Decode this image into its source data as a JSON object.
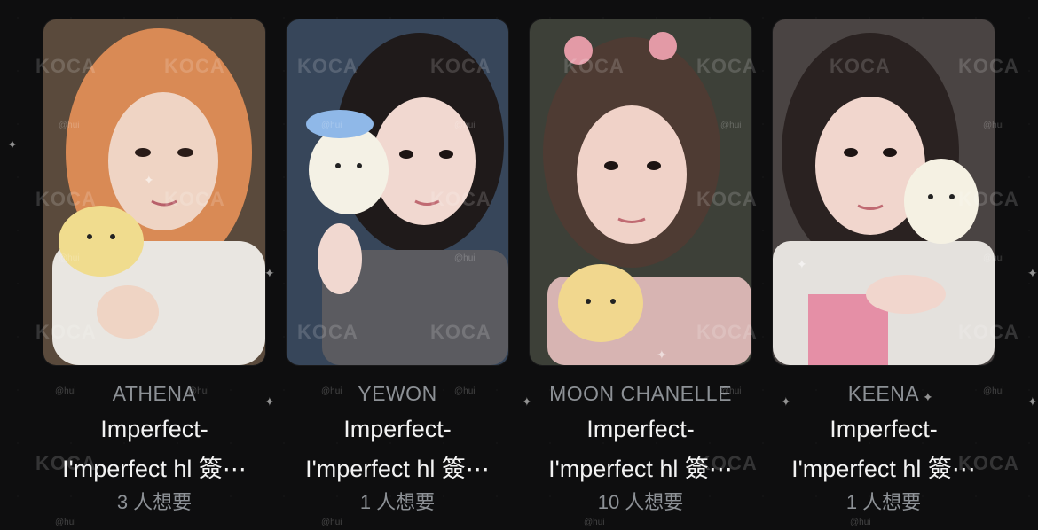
{
  "watermark": {
    "brand": "KOCA",
    "handle": "@hui"
  },
  "cards": [
    {
      "member": "ATHENA",
      "title_line1": "Imperfect-",
      "title_line2": "I'mperfect hl 簽⋯",
      "wants": "3 人想要",
      "colors": {
        "bg": "#5a4a3c",
        "hair": "#d98a55",
        "skin": "#efd4c4",
        "shirt": "#e9e6e1",
        "plush": "#f0dc8e"
      }
    },
    {
      "member": "YEWON",
      "title_line1": "Imperfect-",
      "title_line2": "I'mperfect hl 簽⋯",
      "wants": "1 人想要",
      "colors": {
        "bg": "#37465a",
        "hair": "#1f1a1a",
        "skin": "#f1d8d0",
        "shirt": "#5b5b60",
        "plush": "#f4f1e5"
      }
    },
    {
      "member": "MOON CHANELLE",
      "title_line1": "Imperfect-",
      "title_line2": "I'mperfect hl 簽⋯",
      "wants": "10 人想要",
      "colors": {
        "bg": "#3d4038",
        "hair": "#4e3b33",
        "skin": "#f0d2c8",
        "shirt": "#d7b4b2",
        "plush": "#f1d78e"
      }
    },
    {
      "member": "KEENA",
      "title_line1": "Imperfect-",
      "title_line2": "I'mperfect hl 簽⋯",
      "wants": "1 人想要",
      "colors": {
        "bg": "#4a4443",
        "hair": "#2a2221",
        "skin": "#f1d6cd",
        "shirt": "#e4e1dd",
        "plush": "#f5f1e3"
      }
    }
  ]
}
